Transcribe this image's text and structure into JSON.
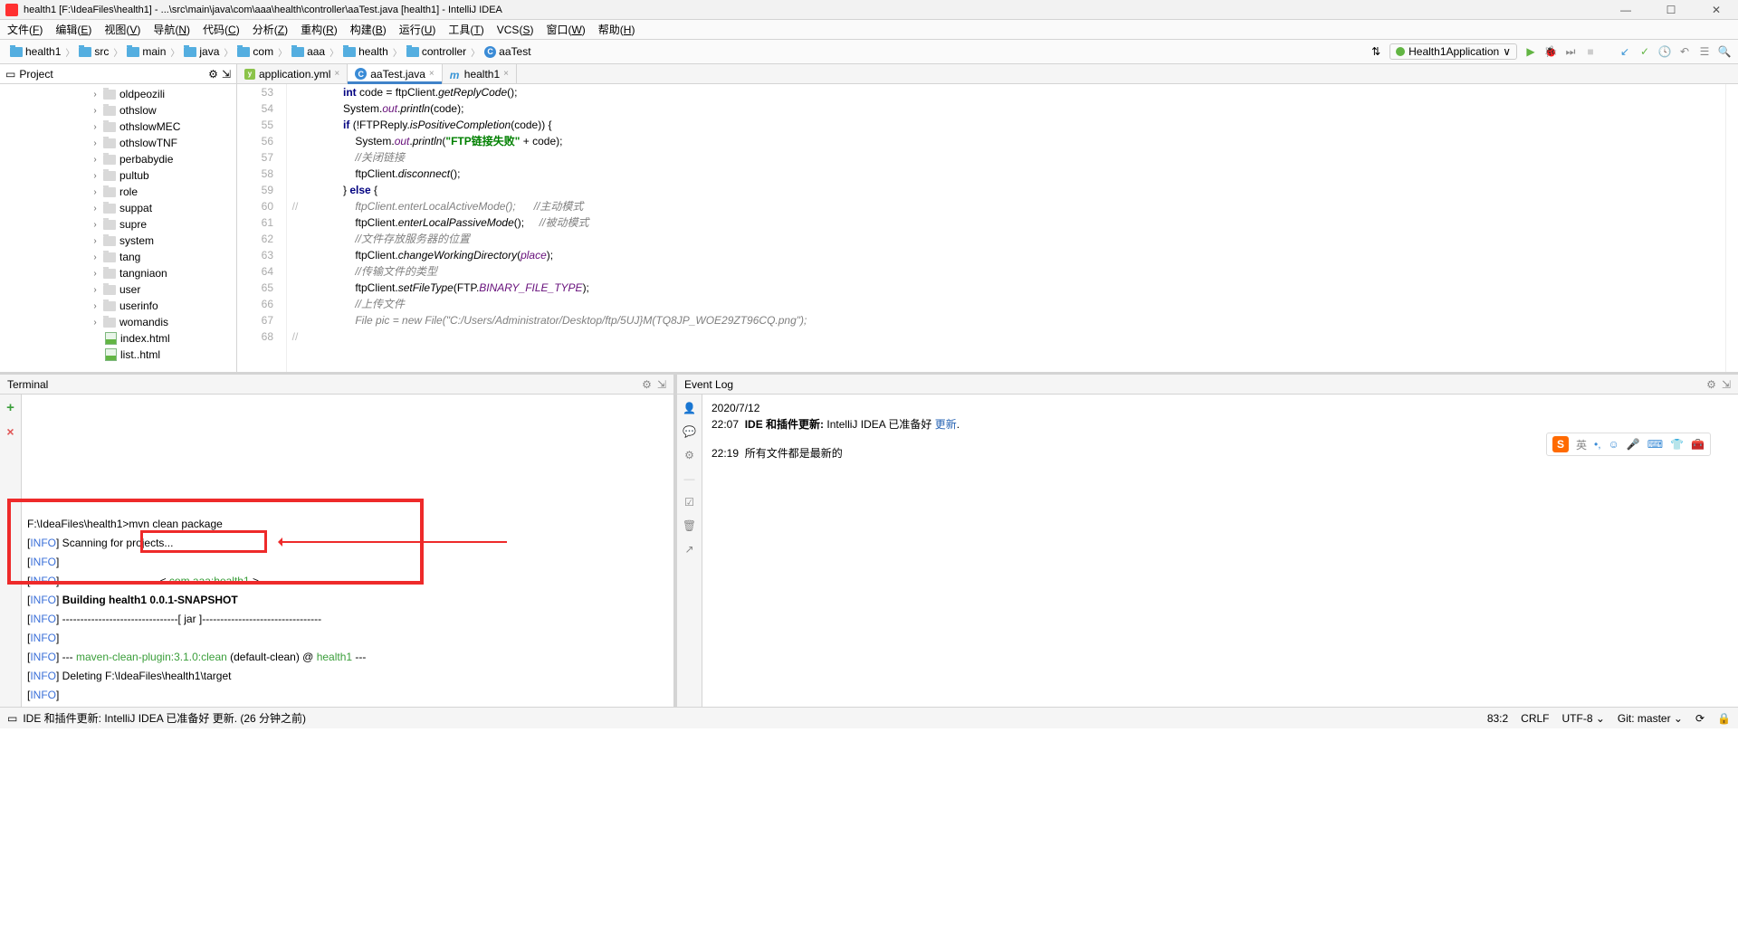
{
  "title": "health1 [F:\\IdeaFiles\\health1] - ...\\src\\main\\java\\com\\aaa\\health\\controller\\aaTest.java [health1] - IntelliJ IDEA",
  "menu": [
    "文件(F)",
    "编辑(E)",
    "视图(V)",
    "导航(N)",
    "代码(C)",
    "分析(Z)",
    "重构(R)",
    "构建(B)",
    "运行(U)",
    "工具(T)",
    "VCS(S)",
    "窗口(W)",
    "帮助(H)"
  ],
  "crumbs": [
    "health1",
    "src",
    "main",
    "java",
    "com",
    "aaa",
    "health",
    "controller",
    "aaTest"
  ],
  "runConfig": "Health1Application",
  "projectLabel": "Project",
  "tree": [
    "oldpeozili",
    "othslow",
    "othslowMEC",
    "othslowTNF",
    "perbabydie",
    "pultub",
    "role",
    "suppat",
    "supre",
    "system",
    "tang",
    "tangniaon",
    "user",
    "userinfo",
    "womandis"
  ],
  "htmlFiles": [
    "index.html",
    "list..html"
  ],
  "tabs": [
    {
      "label": "application.yml",
      "type": "yml"
    },
    {
      "label": "aaTest.java",
      "type": "class",
      "active": true
    },
    {
      "label": "health1",
      "type": "m"
    }
  ],
  "lines": [
    "53",
    "54",
    "55",
    "56",
    "57",
    "58",
    "59",
    "60",
    "61",
    "62",
    "63",
    "64",
    "65",
    "66",
    "67",
    "68",
    ""
  ],
  "glyphs": [
    "",
    "",
    "",
    "",
    "",
    "",
    "",
    "//",
    "",
    "",
    "",
    "",
    "",
    "",
    "",
    "//",
    ""
  ],
  "code": {
    "l53": {
      "pre": "            ",
      "kw": "int",
      "mid": " code = ftpClient.",
      "mth": "getReplyCode",
      "end": "();"
    },
    "l54": {
      "pre": "            System.",
      "fld": "out",
      ".": ".",
      "mth": "println",
      "end": "(code);"
    },
    "l55": {
      "pre": "            ",
      "kw": "if",
      "mid": " (!FTPReply.",
      "mth": "isPositiveCompletion",
      "end": "(code)) {"
    },
    "l56": {
      "pre": "                System.",
      "fld": "out",
      ".": ".",
      "mth": "println",
      "op": "(",
      "str": "\"FTP链接失败\"",
      "end": " + code);"
    },
    "l57": "                //关闭链接",
    "l58": {
      "pre": "                ftpClient.",
      "mth": "disconnect",
      "end": "();"
    },
    "l59": {
      "pre": "            } ",
      "kw": "else",
      "end": " {"
    },
    "l60": "                ftpClient.enterLocalActiveMode();      //主动模式",
    "l61": {
      "pre": "                ftpClient.",
      "mth": "enterLocalPassiveMode",
      "end": "();     ",
      "com": "//被动模式"
    },
    "l62": "                //文件存放服务器的位置",
    "l63": {
      "pre": "                ftpClient.",
      "mth": "changeWorkingDirectory",
      "op": "(",
      "fld": "place",
      "end": ");"
    },
    "l64": "                //传输文件的类型",
    "l65": {
      "pre": "                ftpClient.",
      "mth": "setFileType",
      "op": "(FTP.",
      "fld": "BINARY_FILE_TYPE",
      "end": ");"
    },
    "l66": "                //上传文件",
    "l67": "",
    "l68": "                File pic = new File(\"C:/Users/Administrator/Desktop/ftp/5UJ}M(TQ8JP_WOE29ZT96CQ.png\");"
  },
  "terminal": {
    "title": "Terminal",
    "prompt": "F:\\IdeaFiles\\health1>",
    "cmd": "mvn clean package",
    "lines": [
      {
        "tag": "[INFO]",
        "txt": " Scanning for projects..."
      },
      {
        "tag": "[INFO]",
        "txt": ""
      },
      {
        "tag": "[INFO]",
        "txt": " ---------------------------< ",
        "plugin": "com.aaa:health1",
        "end": " >---------------------------"
      },
      {
        "tag": "[INFO]",
        "bold": " Building health1 0.0.1-SNAPSHOT"
      },
      {
        "tag": "[INFO]",
        "txt": " --------------------------------[ jar ]---------------------------------"
      },
      {
        "tag": "[INFO]",
        "txt": ""
      },
      {
        "tag": "[INFO]",
        "txt": " --- ",
        "plugin": "maven-clean-plugin:3.1.0:clean",
        "mid": " (default-clean) @ ",
        "plugin2": "health1",
        "end": " ---"
      },
      {
        "tag": "[INFO]",
        "txt": " Deleting F:\\IdeaFiles\\health1\\target"
      },
      {
        "tag": "[INFO]",
        "txt": ""
      }
    ]
  },
  "eventLog": {
    "title": "Event Log",
    "date": "2020/7/12",
    "e1time": "22:07",
    "e1bold": "IDE 和插件更新:",
    "e1txt": " IntelliJ IDEA 已准备好 ",
    "e1link": "更新",
    "e2time": "22:19",
    "e2txt": "所有文件都是最新的"
  },
  "status": {
    "left": "IDE 和插件更新: IntelliJ IDEA 已准备好 更新. (26 分钟之前)",
    "pos": "83:2",
    "crlf": "CRLF",
    "enc": "UTF-8",
    "git": "Git: master"
  },
  "sogou": {
    "label": "英"
  },
  "windowControls": {
    "min": "—",
    "max": "☐",
    "close": "✕"
  }
}
